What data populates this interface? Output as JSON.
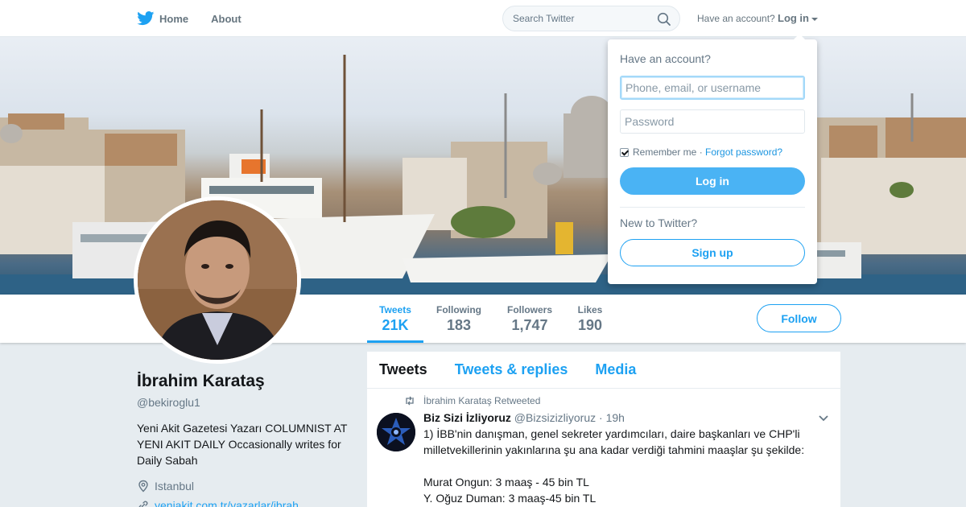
{
  "nav": {
    "home_label": "Home",
    "about_label": "About",
    "search_placeholder": "Search Twitter",
    "have_account": "Have an account?",
    "login_label": "Log in"
  },
  "profile": {
    "name": "İbrahim Karataş",
    "handle": "@bekiroglu1",
    "bio": "Yeni Akit Gazetesi Yazarı COLUMNIST AT YENI AKIT DAILY Occasionally writes for Daily Sabah",
    "location": "Istanbul",
    "link": "yeniakit.com.tr/yazarlar/ibrah..."
  },
  "stats": [
    {
      "label": "Tweets",
      "value": "21K"
    },
    {
      "label": "Following",
      "value": "183"
    },
    {
      "label": "Followers",
      "value": "1,747"
    },
    {
      "label": "Likes",
      "value": "190"
    }
  ],
  "follow_label": "Follow",
  "timeline": {
    "tabs": [
      "Tweets",
      "Tweets & replies",
      "Media"
    ],
    "retweet_note": "İbrahim Karataş Retweeted",
    "tweet": {
      "author": "Biz Sizi İzliyoruz",
      "handle": "@Bizsizizliyoruz",
      "time": "· 19h",
      "lines": [
        "1) İBB'nin danışman, genel sekreter yardımcıları, daire başkanları ve CHP'li milletvekillerinin yakınlarına şu ana kadar verdiği tahmini maaşlar şu şekilde:",
        "",
        "Murat Ongun: 3 maaş - 45 bin TL",
        "Y. Oğuz Duman: 3 maaş-45 bin TL"
      ]
    }
  },
  "login_dropdown": {
    "title": "Have an account?",
    "username_placeholder": "Phone, email, or username",
    "password_placeholder": "Password",
    "remember_label": "Remember me ·",
    "forgot_label": "Forgot password?",
    "login_button": "Log in",
    "new_to_twitter": "New to Twitter?",
    "signup_button": "Sign up"
  },
  "colors": {
    "accent": "#1da1f2",
    "login_button": "#4ab3f4",
    "background": "#e6ecf0"
  }
}
